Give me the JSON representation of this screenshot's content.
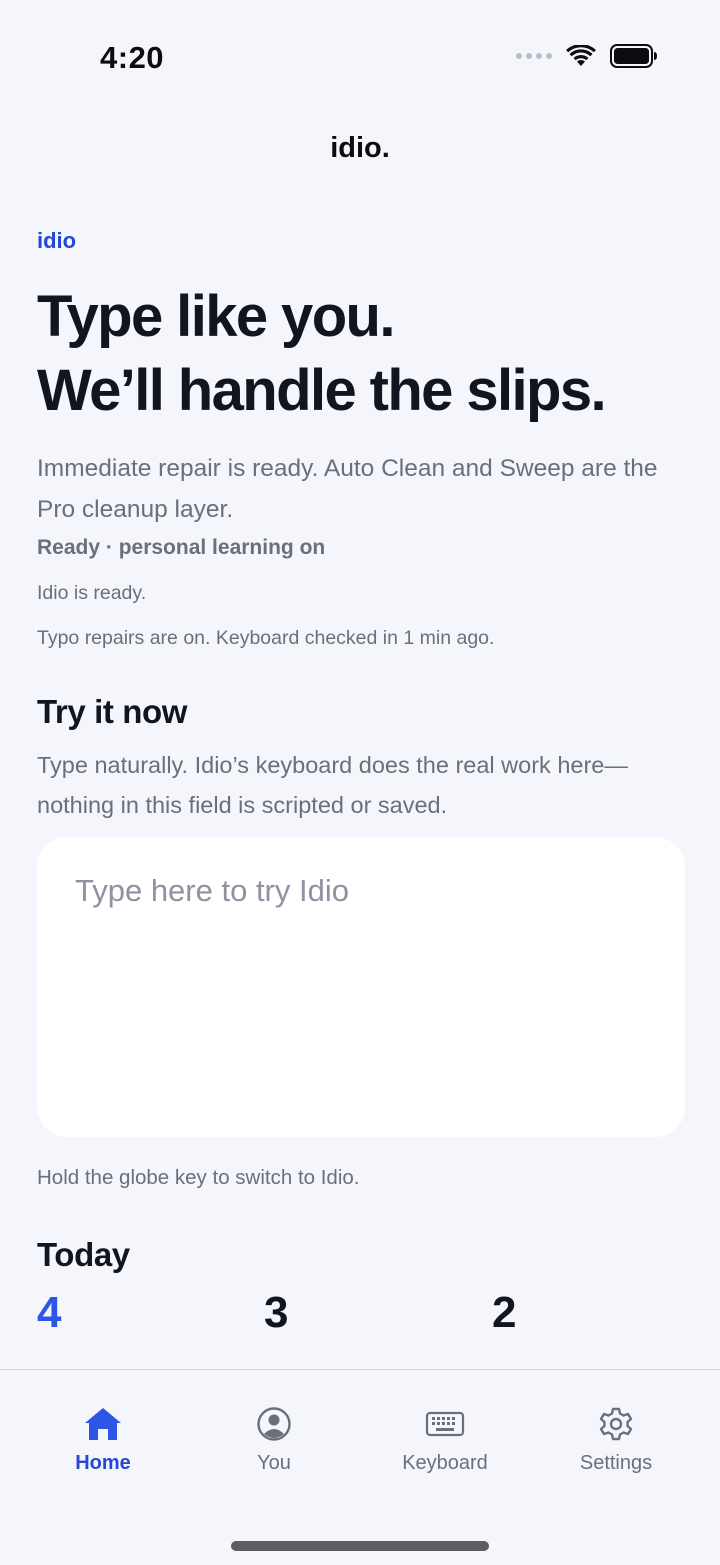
{
  "status_bar": {
    "time": "4:20",
    "icons": [
      "signal-dots-icon",
      "wifi-icon",
      "battery-icon"
    ]
  },
  "header": {
    "title": "idio."
  },
  "hero": {
    "tag": "idio",
    "title_line1": "Type like you.",
    "title_line2": "We’ll handle the slips.",
    "subtitle": "Immediate repair is ready. Auto Clean and Sweep are the Pro cleanup layer.",
    "status_line": "Ready · personal learning on",
    "ready_note": "Idio is ready.",
    "repairs_note": "Typo repairs are on. Keyboard checked in 1 min ago."
  },
  "try_it": {
    "title": "Try it now",
    "description": "Type naturally. Idio’s keyboard does the real work here—nothing in this field is scripted or saved.",
    "input_value": "",
    "placeholder": "Type here to try Idio",
    "hint": "Hold the globe key to switch to Idio."
  },
  "today": {
    "title": "Today",
    "stats": [
      "4",
      "3",
      "2"
    ]
  },
  "tabs": [
    {
      "label": "Home",
      "icon": "home-icon",
      "active": true
    },
    {
      "label": "You",
      "icon": "person-circle-icon",
      "active": false
    },
    {
      "label": "Keyboard",
      "icon": "keyboard-icon",
      "active": false
    },
    {
      "label": "Settings",
      "icon": "gear-icon",
      "active": false
    }
  ],
  "colors": {
    "accent": "#2547d6",
    "background": "#f5f6fb",
    "muted_text": "#6b6f7b"
  }
}
